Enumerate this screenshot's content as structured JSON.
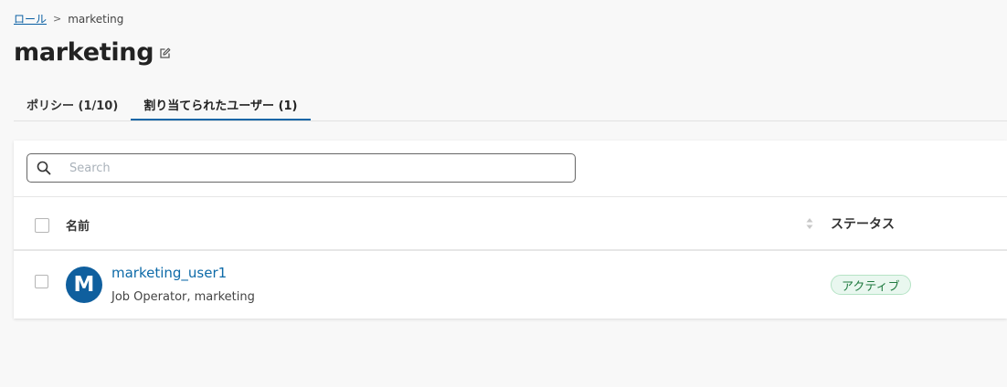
{
  "breadcrumb": {
    "root": "ロール",
    "separator": ">",
    "current": "marketing"
  },
  "page": {
    "title": "marketing"
  },
  "tabs": [
    {
      "label": "ポリシー (1/10)",
      "active": false
    },
    {
      "label": "割り当てられたユーザー (1)",
      "active": true
    }
  ],
  "search": {
    "placeholder": "Search",
    "value": ""
  },
  "table": {
    "columns": {
      "name": "名前",
      "status": "ステータス"
    },
    "rows": [
      {
        "avatar_letter": "M",
        "name": "marketing_user1",
        "roles": "Job Operator, marketing",
        "status": "アクティブ"
      }
    ]
  },
  "colors": {
    "accent": "#1266a6",
    "avatar": "#0f5f9e",
    "status_active_bg": "#e9f7ef",
    "status_active_text": "#1f7a3f"
  },
  "icons": [
    "edit-icon",
    "search-icon",
    "sort-icon"
  ]
}
